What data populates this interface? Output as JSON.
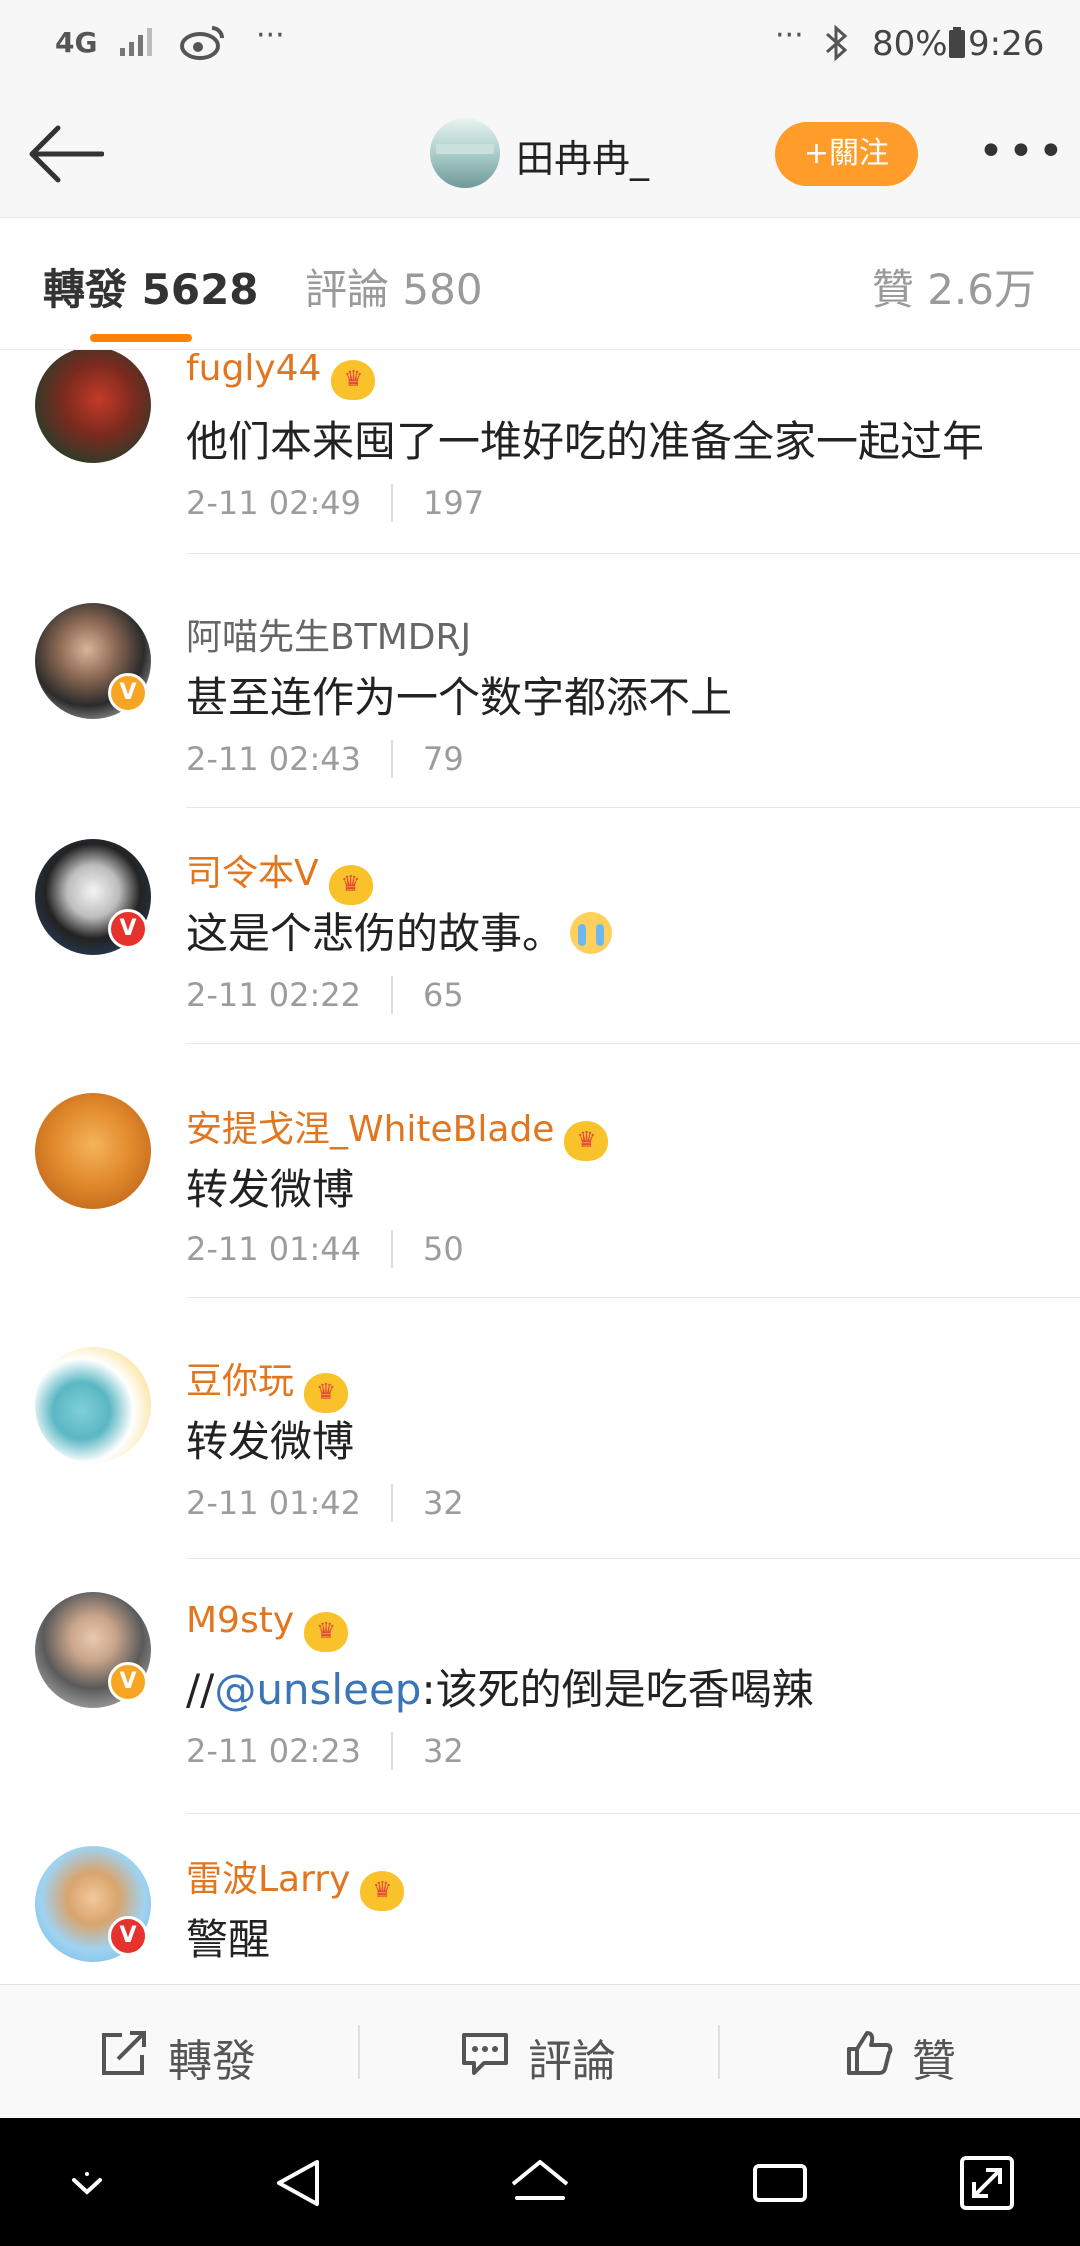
{
  "status_bar": {
    "network": "4G",
    "dots_left": "···",
    "dots_right": "···",
    "battery": "80%",
    "time": "9:26"
  },
  "header": {
    "user_name": "田冉冉_",
    "follow_label": "+關注",
    "more_label": "•••"
  },
  "tabs": {
    "repost_label": "轉發",
    "repost_count": "5628",
    "comment_label": "評論",
    "comment_count": "580",
    "like_label": "贊",
    "like_count": "2.6万",
    "active": "repost"
  },
  "reposts": [
    {
      "user": "fugly44",
      "text": "他们本来囤了一堆好吃的准备全家一起过年",
      "time": "2-11 02:49",
      "likes": "197"
    },
    {
      "user": "阿喵先生BTMDRJ",
      "text": "甚至连作为一个数字都添不上",
      "time": "2-11 02:43",
      "likes": "79"
    },
    {
      "user": "司令本V",
      "text": "这是个悲伤的故事。",
      "time": "2-11 02:22",
      "likes": "65"
    },
    {
      "user": "安提戈涅_WhiteBlade",
      "text": "转发微博",
      "time": "2-11 01:44",
      "likes": "50"
    },
    {
      "user": "豆你玩",
      "text": "转发微博",
      "time": "2-11 01:42",
      "likes": "32"
    },
    {
      "user": "M9sty",
      "text_prefix": "//",
      "mention": "@unsleep",
      "text_suffix": ":该死的倒是吃香喝辣",
      "time": "2-11 02:23",
      "likes": "32"
    },
    {
      "user": "雷波Larry",
      "text": "警醒"
    }
  ],
  "verified_badge": "V",
  "action_bar": {
    "repost": "轉發",
    "comment": "評論",
    "like": "贊"
  },
  "colors": {
    "accent_orange": "#ff8200",
    "follow_button": "#ff9c2a",
    "vip_name": "#e2761f",
    "mention_link": "#3a75b8"
  }
}
